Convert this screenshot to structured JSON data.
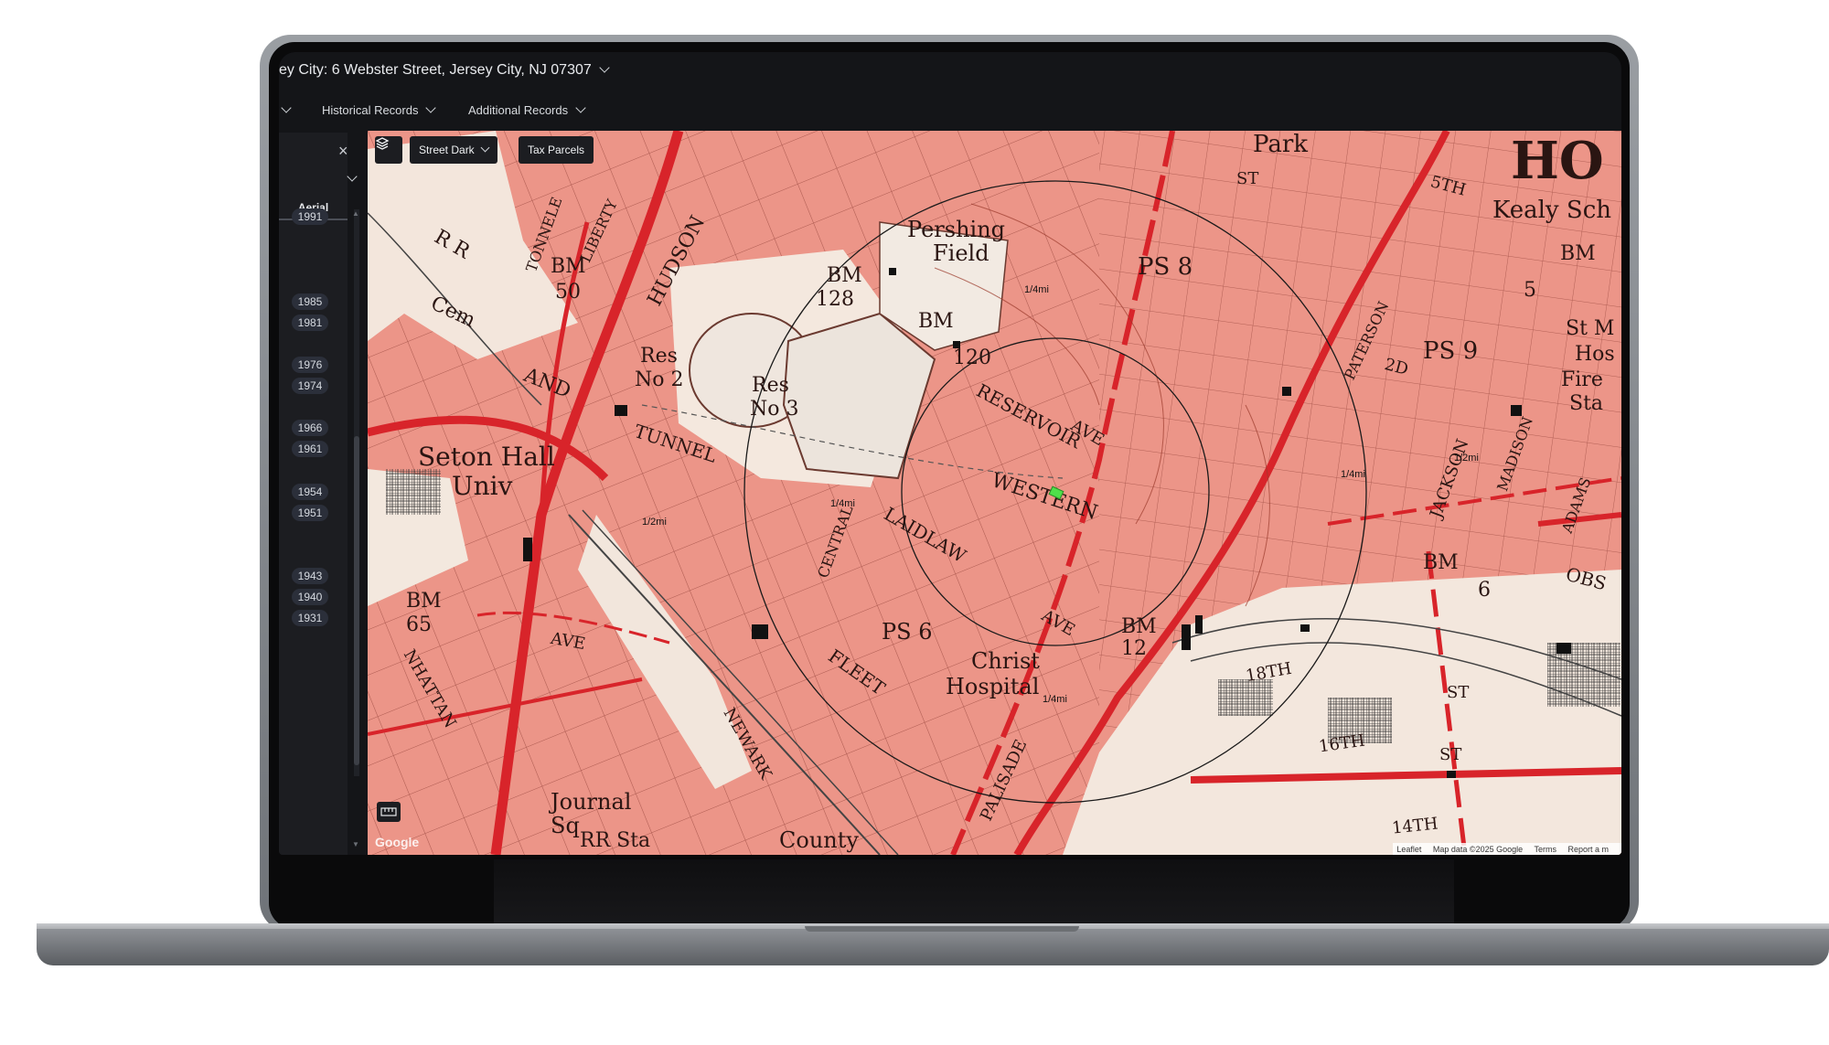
{
  "header": {
    "address": "ey City: 6 Webster Street, Jersey City, NJ 07307"
  },
  "menu": {
    "historical_records": "Historical Records",
    "additional_records": "Additional Records"
  },
  "panel": {
    "close": "×",
    "tab": "Aerial",
    "years": [
      "1991",
      "1985",
      "1981",
      "1976",
      "1974",
      "1966",
      "1961",
      "1954",
      "1951",
      "1943",
      "1940",
      "1931"
    ]
  },
  "map": {
    "layer_label": "Street Dark",
    "tax_parcels": "Tax Parcels",
    "google": "Google",
    "attribution": {
      "leaflet": "Leaflet",
      "mapdata": "Map data ©2025 Google",
      "terms": "Terms",
      "report": "Report a m"
    },
    "rings": {
      "quarter": "1/4mi",
      "half": "1/2mi"
    },
    "labels": {
      "res2a": "Res",
      "res2b": "No 2",
      "res3a": "Res",
      "res3b": "No 3",
      "pershing": "Pershing",
      "field": "Field",
      "seton": "Seton Hall",
      "univ": "Univ",
      "tunnel": "TUNNEL",
      "western": "WESTERN",
      "laidlaw": "LAIDLAW",
      "reservoir": "RESERVOIR",
      "christ": "Christ",
      "hospital": "Hospital",
      "ps8": "PS 8",
      "ps9": "PS 9",
      "ps6": "PS 6",
      "park": "Park",
      "kealy": "Kealy Sch",
      "ho": "HO",
      "hudson": "HUDSON",
      "journal": "Journal",
      "county": "County",
      "bm128": "BM",
      "n128": "128",
      "bm120": "BM",
      "n120": "120",
      "bm50": "BM",
      "n50": "50",
      "bm65": "BM",
      "n65": "65",
      "bm5": "BM",
      "n5": "5",
      "bm12": "BM",
      "n12": "12",
      "bm6": "BM",
      "n6": "6",
      "avea": "AVE",
      "aveb": "AVE",
      "avec": "AVE",
      "fleet": "FLEET",
      "newark": "NEWARK",
      "palisade": "PALISADE",
      "central": "CENTRAL",
      "jackson": "JACKSON",
      "madison": "MADISON",
      "adams": "ADAMS",
      "paterson": "PATERSON",
      "s18th": "18TH",
      "s16th": "16TH",
      "s14th": "14TH",
      "st1": "ST",
      "st2": "ST",
      "st3": "ST",
      "and": "AND",
      "rr": "R R",
      "cem": "Cem",
      "tonnele": "TONNELE",
      "liberty": "LIBERTY",
      "s5th": "5TH",
      "fire": "Fire",
      "sta": "Sta",
      "hos": "Hos",
      "stm": "St M",
      "obs": "OBS",
      "s2d": "2D",
      "manhattan": "NHATTAN",
      "rrsta": "RR Sta",
      "sq": "Sq"
    }
  }
}
